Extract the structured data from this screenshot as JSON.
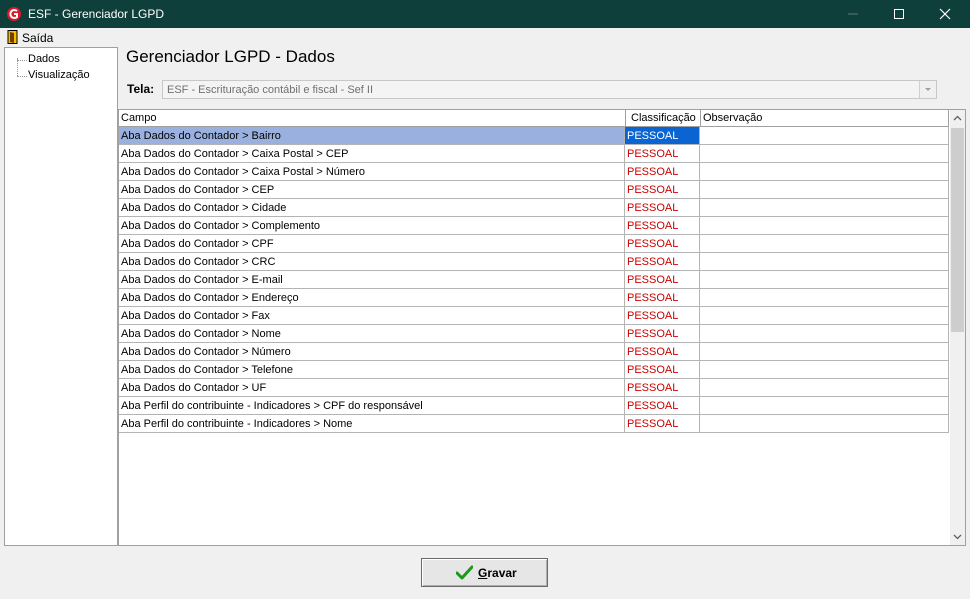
{
  "window": {
    "title": "ESF - Gerenciador LGPD",
    "app_icon": "esf-logo-icon",
    "accent": "#0f3f3a"
  },
  "menubar": {
    "items": [
      {
        "label": "Saída",
        "icon": "exit-door-icon"
      }
    ]
  },
  "tree": {
    "items": [
      {
        "label": "Dados"
      },
      {
        "label": "Visualização"
      }
    ]
  },
  "page": {
    "title": "Gerenciador LGPD - Dados",
    "tela_label": "Tela:",
    "tela_value": "ESF - Escrituração contábil e fiscal - Sef II"
  },
  "grid": {
    "columns": [
      "Campo",
      "Classificação",
      "Observação"
    ],
    "rows": [
      {
        "campo": "Aba Dados do Contador > Bairro",
        "classificacao": "PESSOAL",
        "observacao": "",
        "selected": true
      },
      {
        "campo": "Aba Dados do Contador > Caixa Postal > CEP",
        "classificacao": "PESSOAL",
        "observacao": ""
      },
      {
        "campo": "Aba Dados do Contador > Caixa Postal > Número",
        "classificacao": "PESSOAL",
        "observacao": ""
      },
      {
        "campo": "Aba Dados do Contador > CEP",
        "classificacao": "PESSOAL",
        "observacao": ""
      },
      {
        "campo": "Aba Dados do Contador > Cidade",
        "classificacao": "PESSOAL",
        "observacao": ""
      },
      {
        "campo": "Aba Dados do Contador > Complemento",
        "classificacao": "PESSOAL",
        "observacao": ""
      },
      {
        "campo": "Aba Dados do Contador > CPF",
        "classificacao": "PESSOAL",
        "observacao": ""
      },
      {
        "campo": "Aba Dados do Contador > CRC",
        "classificacao": "PESSOAL",
        "observacao": ""
      },
      {
        "campo": "Aba Dados do Contador > E-mail",
        "classificacao": "PESSOAL",
        "observacao": ""
      },
      {
        "campo": "Aba Dados do Contador > Endereço",
        "classificacao": "PESSOAL",
        "observacao": ""
      },
      {
        "campo": "Aba Dados do Contador > Fax",
        "classificacao": "PESSOAL",
        "observacao": ""
      },
      {
        "campo": "Aba Dados do Contador > Nome",
        "classificacao": "PESSOAL",
        "observacao": ""
      },
      {
        "campo": "Aba Dados do Contador > Número",
        "classificacao": "PESSOAL",
        "observacao": ""
      },
      {
        "campo": "Aba Dados do Contador > Telefone",
        "classificacao": "PESSOAL",
        "observacao": ""
      },
      {
        "campo": "Aba Dados do Contador > UF",
        "classificacao": "PESSOAL",
        "observacao": ""
      },
      {
        "campo": "Aba Perfil do contribuinte - Indicadores > CPF do responsável",
        "classificacao": "PESSOAL",
        "observacao": ""
      },
      {
        "campo": "Aba Perfil do contribuinte - Indicadores > Nome",
        "classificacao": "PESSOAL",
        "observacao": ""
      }
    ],
    "classification_color": "#cc0000",
    "selected_color": "#0a64d2"
  },
  "footer": {
    "save_label": "Gravar",
    "save_icon": "green-check-icon"
  }
}
